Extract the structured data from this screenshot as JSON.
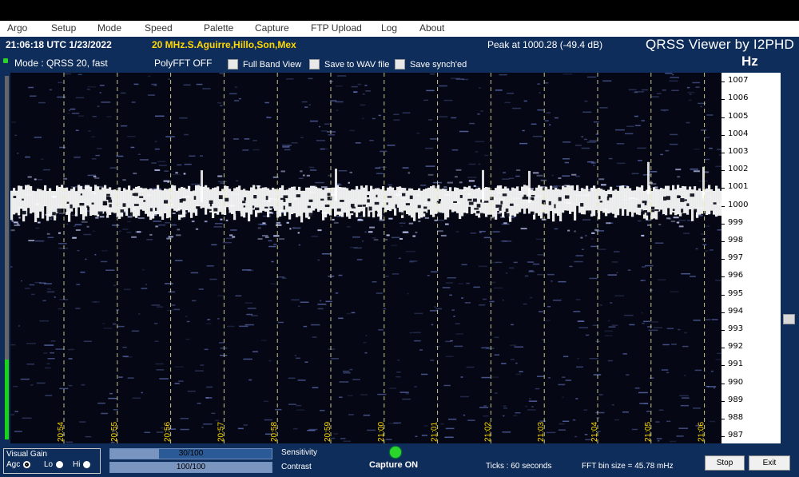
{
  "menu": [
    "Argo",
    "Setup",
    "Mode",
    "Speed",
    "Palette",
    "Capture",
    "FTP Upload",
    "Log",
    "About"
  ],
  "header": {
    "time": "21:06:18 UTC  1/23/2022",
    "station": "20 MHz.S.Aguirre,Hillo,Son,Mex",
    "peak": "Peak at    1000.28 (-49.4 dB)",
    "app_title": "QRSS Viewer by I2PHD",
    "unit": "Hz"
  },
  "status": {
    "mode": "Mode : QRSS 20, fast",
    "polyfft": "PolyFFT OFF"
  },
  "options": [
    {
      "label": "Full Band View",
      "checked": false
    },
    {
      "label": "Save to WAV file",
      "checked": false
    },
    {
      "label": "Save synch'ed",
      "checked": false
    }
  ],
  "waterfall": {
    "time_labels": [
      "20:54",
      "20:55",
      "20:56",
      "20:57",
      "20:58",
      "20:59",
      "21:00",
      "21:01",
      "21:02",
      "21:03",
      "21:04",
      "21:05",
      "21:06"
    ],
    "signal_freq_hz": 1000.28,
    "colors": {
      "background": "#050814",
      "signal": "#ffffff",
      "noise": "#6f7fd0",
      "gridline": "#e8e8a0",
      "timelabel": "#ffd800"
    }
  },
  "freq_scale": [
    "1007",
    "1006",
    "1005",
    "1004",
    "1003",
    "1002",
    "1001",
    "1000",
    "999",
    "998",
    "997",
    "996",
    "995",
    "994",
    "993",
    "992",
    "991",
    "990",
    "989",
    "988",
    "987"
  ],
  "visual_gain": {
    "title": "Visual Gain",
    "options": [
      {
        "label": "Agc",
        "selected": true
      },
      {
        "label": "Lo",
        "selected": false
      },
      {
        "label": "Hi",
        "selected": false
      }
    ]
  },
  "sensitivity": {
    "label": "Sensitivity",
    "value": "30/100",
    "fraction": 0.3
  },
  "contrast": {
    "label": "Contrast",
    "value": "100/100",
    "fraction": 1.0
  },
  "capture_label": "Capture ON",
  "ticks_text": "Ticks  : 60 seconds",
  "fft_text": "FFT bin size = 45.78 mHz",
  "buttons": {
    "stop": "Stop",
    "exit": "Exit"
  },
  "level_fraction": 0.22
}
